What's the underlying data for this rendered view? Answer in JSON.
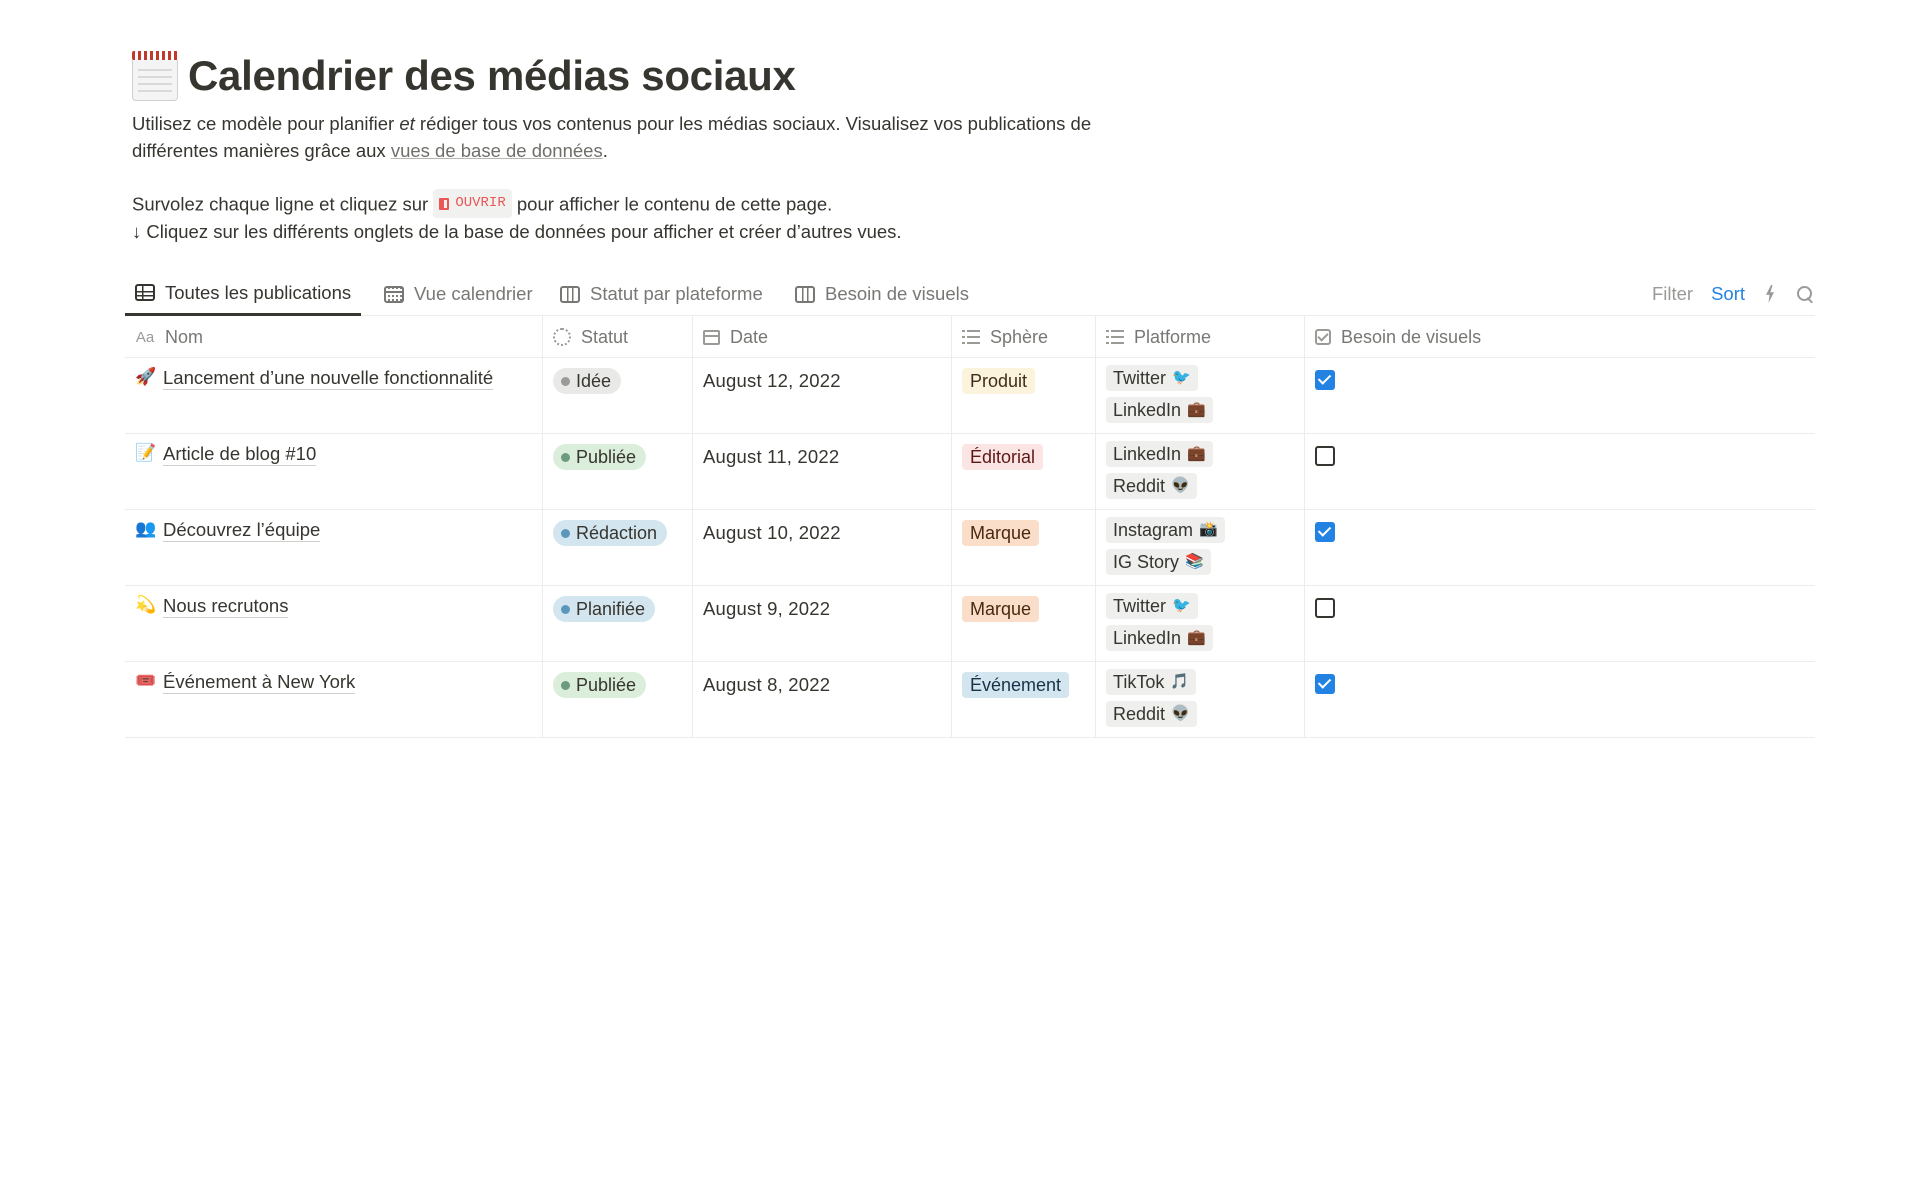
{
  "page": {
    "title": "Calendrier des médias sociaux",
    "title_icon": "spiral-calendar-icon",
    "intro": {
      "text_1": "Utilisez ce modèle pour planifier ",
      "text_em": "et",
      "text_2": " rédiger tous vos contenus pour les médias sociaux. Visualisez vos publications de différentes manières grâce aux ",
      "link": "vues de base de données",
      "text_3": "."
    },
    "hint": {
      "text_1": "Survolez chaque ligne et cliquez sur ",
      "chip": "OUVRIR",
      "text_2": " pour afficher le contenu de cette page.",
      "line_2": "↓ Cliquez sur les différents onglets de la base de données pour afficher et créer d’autres vues."
    }
  },
  "views": {
    "tabs": [
      {
        "label": "Toutes les publications",
        "icon": "table-icon",
        "active": true
      },
      {
        "label": "Vue calendrier",
        "icon": "calendar-icon",
        "active": false
      },
      {
        "label": "Statut par plateforme",
        "icon": "board-icon",
        "active": false
      },
      {
        "label": "Besoin de visuels",
        "icon": "board-icon",
        "active": false
      }
    ],
    "tools": {
      "filter": "Filter",
      "sort": "Sort"
    }
  },
  "table": {
    "columns": [
      {
        "label": "Nom",
        "icon": "Aa"
      },
      {
        "label": "Statut",
        "icon": "status-icon"
      },
      {
        "label": "Date",
        "icon": "calendar-icon"
      },
      {
        "label": "Sphère",
        "icon": "list-icon"
      },
      {
        "label": "Platforme",
        "icon": "list-icon"
      },
      {
        "label": "Besoin de visuels",
        "icon": "checkbox-icon"
      }
    ],
    "rows": [
      {
        "emoji": "🚀",
        "name": "Lancement d’une nouvelle fonctionnalité",
        "status": "Idée",
        "status_color": "#9b9a97",
        "status_bg": "#e9e9e7",
        "date": "August 12, 2022",
        "sphere": "Produit",
        "sphere_bg": "#fbf3db",
        "sphere_color": "#402c1b",
        "platforms": [
          {
            "name": "Twitter",
            "emoji": "🐦"
          },
          {
            "name": "LinkedIn",
            "emoji": "💼"
          }
        ],
        "needs_visuals": true
      },
      {
        "emoji": "📝",
        "name": "Article de blog #10",
        "status": "Publiée",
        "status_color": "#6c9b7d",
        "status_bg": "#dbeddb",
        "date": "August 11, 2022",
        "sphere": "Éditorial",
        "sphere_bg": "#fbe4e4",
        "sphere_color": "#5d1715",
        "platforms": [
          {
            "name": "LinkedIn",
            "emoji": "💼"
          },
          {
            "name": "Reddit",
            "emoji": "👽"
          }
        ],
        "needs_visuals": false
      },
      {
        "emoji": "👥",
        "name": "Découvrez l’équipe",
        "status": "Rédaction",
        "status_color": "#5b97bd",
        "status_bg": "#d3e5ef",
        "date": "August 10, 2022",
        "sphere": "Marque",
        "sphere_bg": "#fadec9",
        "sphere_color": "#49290e",
        "platforms": [
          {
            "name": "Instagram",
            "emoji": "📸"
          },
          {
            "name": "IG Story",
            "emoji": "📚"
          }
        ],
        "needs_visuals": true
      },
      {
        "emoji": "💫",
        "name": "Nous recrutons",
        "status": "Planifiée",
        "status_color": "#5b97bd",
        "status_bg": "#d3e5ef",
        "date": "August 9, 2022",
        "sphere": "Marque",
        "sphere_bg": "#fadec9",
        "sphere_color": "#49290e",
        "platforms": [
          {
            "name": "Twitter",
            "emoji": "🐦"
          },
          {
            "name": "LinkedIn",
            "emoji": "💼"
          }
        ],
        "needs_visuals": false
      },
      {
        "emoji": "🎟️",
        "name": "Événement à New York",
        "status": "Publiée",
        "status_color": "#6c9b7d",
        "status_bg": "#dbeddb",
        "date": "August 8, 2022",
        "sphere": "Événement",
        "sphere_bg": "#d3e5ef",
        "sphere_color": "#183347",
        "platforms": [
          {
            "name": "TikTok",
            "emoji": "🎵"
          },
          {
            "name": "Reddit",
            "emoji": "👽"
          }
        ],
        "needs_visuals": true
      }
    ]
  }
}
